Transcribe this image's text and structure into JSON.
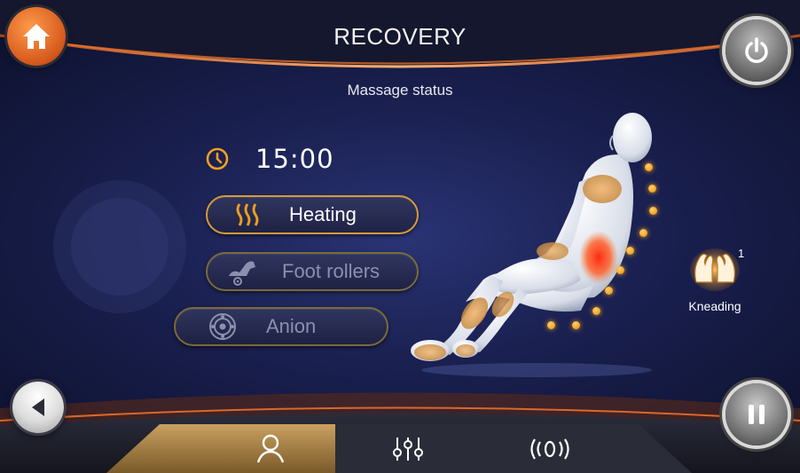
{
  "header": {
    "title": "RECOVERY",
    "subtitle": "Massage status"
  },
  "timer": {
    "icon": "clock-icon",
    "value": "15:00"
  },
  "functions": [
    {
      "label": "Heating",
      "icon": "heat-waves-icon",
      "state": "active"
    },
    {
      "label": "Foot rollers",
      "icon": "foot-roller-icon",
      "state": "inactive"
    },
    {
      "label": "Anion",
      "icon": "anion-icon",
      "state": "inactive"
    }
  ],
  "technique": {
    "label": "Kneading",
    "level": "1",
    "icon": "kneading-hands-icon"
  },
  "controls": {
    "home": "home-icon",
    "power": "power-icon",
    "back": "back-arrow-icon",
    "pause": "pause-icon"
  },
  "tabs": [
    {
      "icon": "person-icon",
      "selected": true
    },
    {
      "icon": "sliders-icon",
      "selected": false
    },
    {
      "icon": "vibration-icon",
      "selected": false
    }
  ],
  "colors": {
    "accent": "#f0a020",
    "heat": "#ff3b1f",
    "background": "#1a2050"
  }
}
